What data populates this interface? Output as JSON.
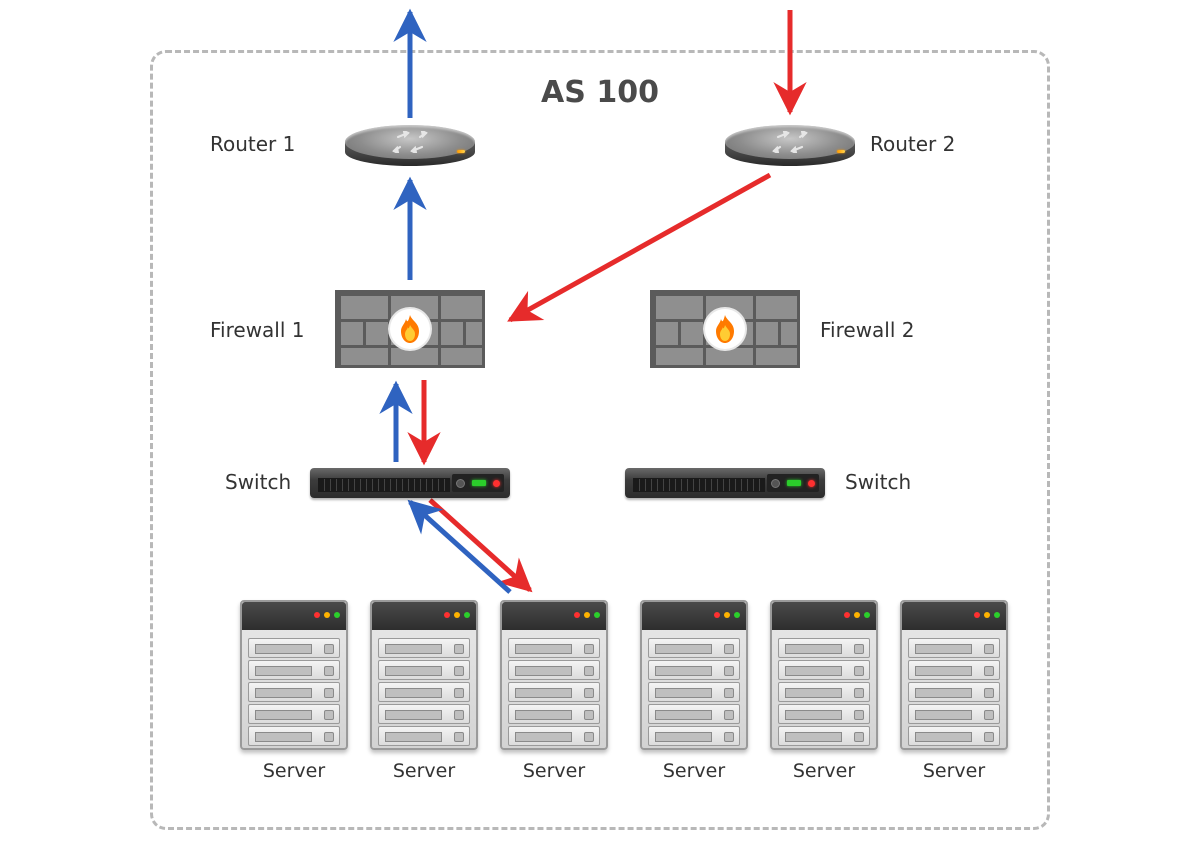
{
  "as_title": "AS 100",
  "labels": {
    "router1": "Router 1",
    "router2": "Router 2",
    "firewall1": "Firewall 1",
    "firewall2": "Firewall 2",
    "switch1": "Switch",
    "switch2": "Switch"
  },
  "servers": [
    "Server",
    "Server",
    "Server",
    "Server",
    "Server",
    "Server"
  ],
  "colors": {
    "blue": "#2f63c0",
    "red": "#e62b2b",
    "box": "#b8b8b8"
  }
}
